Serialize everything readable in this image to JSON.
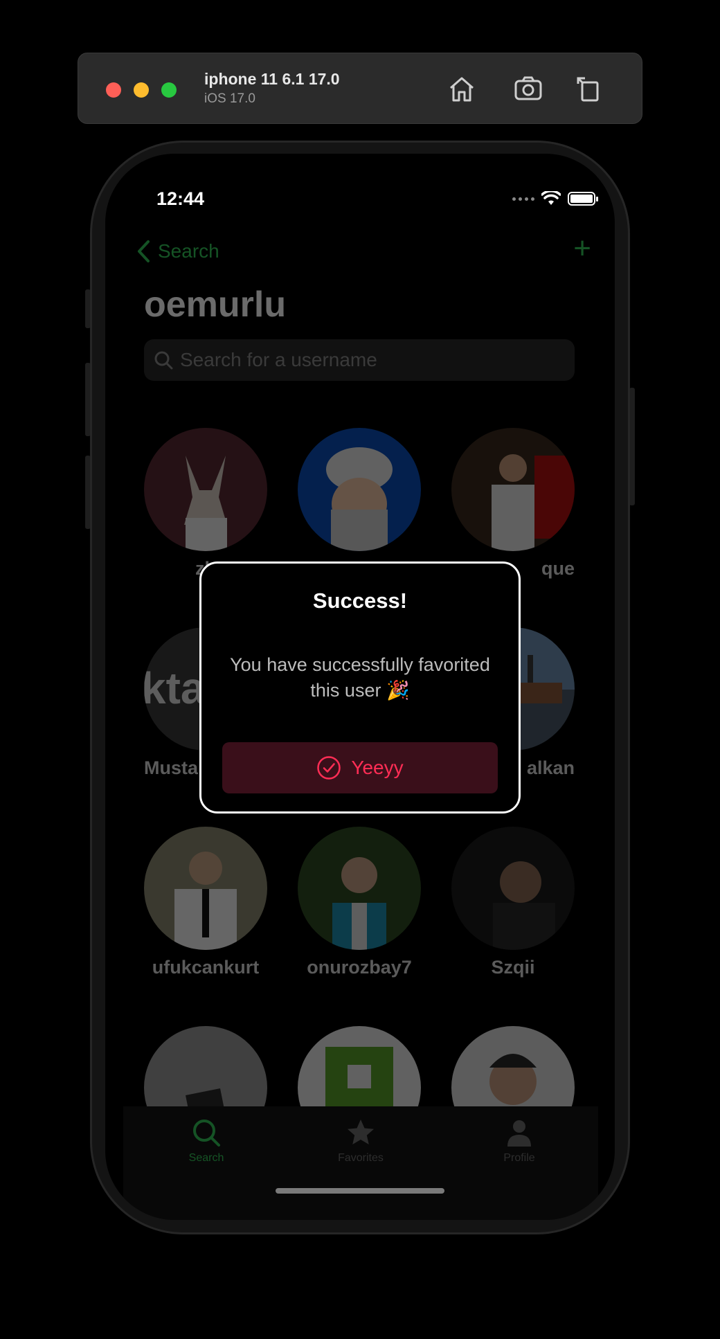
{
  "simulator": {
    "device_name": "iphone 11 6.1 17.0",
    "os_version": "iOS 17.0",
    "icons": [
      "home-icon",
      "screenshot-icon",
      "rotate-icon"
    ]
  },
  "status_bar": {
    "time": "12:44",
    "icons": [
      "cellular-icon",
      "wifi-icon",
      "battery-icon"
    ]
  },
  "nav": {
    "back_label": "Search",
    "title": "oemurlu",
    "add_icon": "plus-icon"
  },
  "search": {
    "placeholder": "Search for a username",
    "value": ""
  },
  "users": [
    {
      "username": "zb",
      "avatar_bg": "#3a1f22"
    },
    {
      "username": "",
      "avatar_bg": "#0a3f8f"
    },
    {
      "username": "que",
      "avatar_bg": "#2a1a12"
    },
    {
      "username": "Musta",
      "avatar_bg": "#333333"
    },
    {
      "username": "",
      "avatar_bg": "#000000"
    },
    {
      "username": "alkan",
      "avatar_bg": "#2a3340"
    },
    {
      "username": "ufukcankurt",
      "avatar_bg": "#6b6a55"
    },
    {
      "username": "onurozbay7",
      "avatar_bg": "#26331f"
    },
    {
      "username": "Szqii",
      "avatar_bg": "#1a1a1a"
    },
    {
      "username": "",
      "avatar_bg": "#8a8a8a"
    },
    {
      "username": "",
      "avatar_bg": "#d9d9d9"
    },
    {
      "username": "",
      "avatar_bg": "#cccccc"
    }
  ],
  "tabs": [
    {
      "label": "Search",
      "icon": "search-icon",
      "active": true
    },
    {
      "label": "Favorites",
      "icon": "star-icon",
      "active": false
    },
    {
      "label": "Profile",
      "icon": "person-icon",
      "active": false
    }
  ],
  "alert": {
    "title": "Success!",
    "message_line1": "You have successfully favorited",
    "message_line2": "this user 🎉",
    "button_label": "Yeeyy",
    "button_icon": "checkmark-circle-icon"
  },
  "colors": {
    "accent": "#34c759",
    "alert_button_text": "#ff2d55",
    "alert_button_bg": "#3a0f1a"
  }
}
